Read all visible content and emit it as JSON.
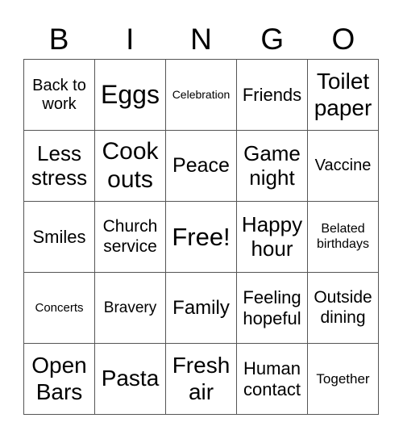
{
  "header": [
    "B",
    "I",
    "N",
    "G",
    "O"
  ],
  "cells": [
    {
      "text": "Back to work",
      "size": 20
    },
    {
      "text": "Eggs",
      "size": 32
    },
    {
      "text": "Celebration",
      "size": 14
    },
    {
      "text": "Friends",
      "size": 22
    },
    {
      "text": "Toilet paper",
      "size": 28
    },
    {
      "text": "Less stress",
      "size": 26
    },
    {
      "text": "Cook outs",
      "size": 30
    },
    {
      "text": "Peace",
      "size": 25
    },
    {
      "text": "Game night",
      "size": 26
    },
    {
      "text": "Vaccine",
      "size": 20
    },
    {
      "text": "Smiles",
      "size": 22
    },
    {
      "text": "Church service",
      "size": 21
    },
    {
      "text": "Free!",
      "size": 31
    },
    {
      "text": "Happy hour",
      "size": 26
    },
    {
      "text": "Belated birthdays",
      "size": 16
    },
    {
      "text": "Concerts",
      "size": 15
    },
    {
      "text": "Bravery",
      "size": 19
    },
    {
      "text": "Family",
      "size": 24
    },
    {
      "text": "Feeling hopeful",
      "size": 22
    },
    {
      "text": "Outside dining",
      "size": 21
    },
    {
      "text": "Open Bars",
      "size": 28
    },
    {
      "text": "Pasta",
      "size": 28
    },
    {
      "text": "Fresh air",
      "size": 28
    },
    {
      "text": "Human contact",
      "size": 22
    },
    {
      "text": "Together",
      "size": 17
    }
  ]
}
